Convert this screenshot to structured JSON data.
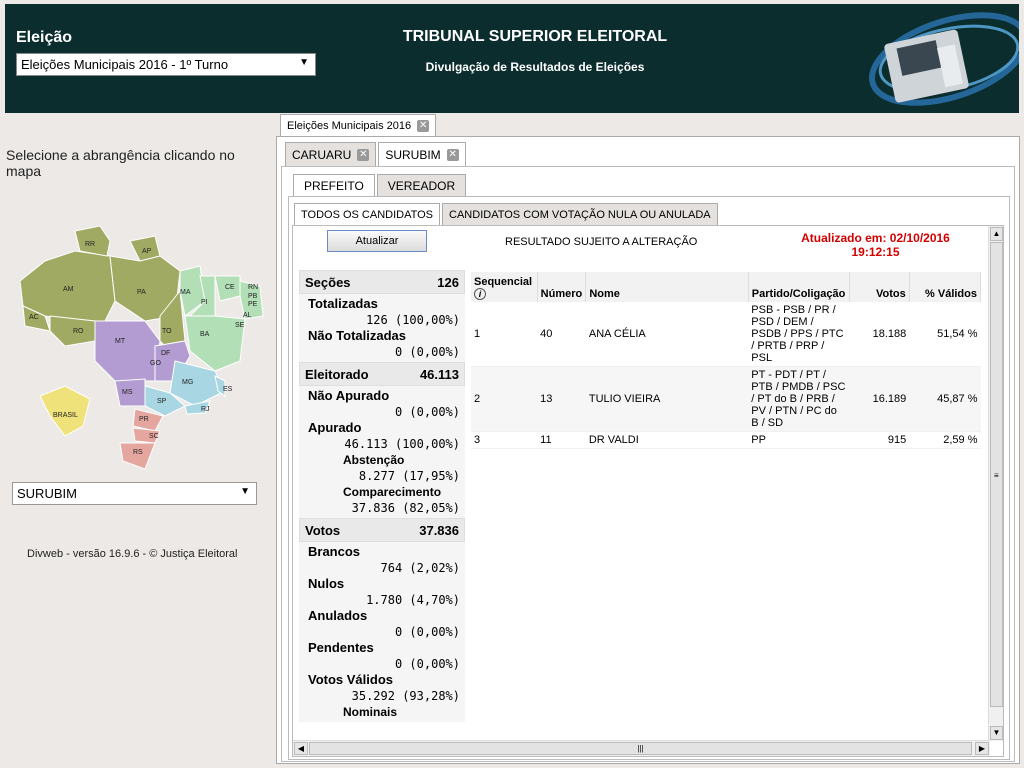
{
  "header": {
    "eleicao_label": "Eleição",
    "eleicao_selected": "Eleições Municipais 2016 - 1º Turno",
    "title": "TRIBUNAL SUPERIOR ELEITORAL",
    "subtitle": "Divulgação de Resultados de Eleições"
  },
  "left": {
    "instruction": "Selecione a abrangência clicando no mapa",
    "municipio_selected": "SURUBIM",
    "footer": "Divweb - versão 16.9.6 - © Justiça Eleitoral",
    "map_labels": [
      "RR",
      "AP",
      "AM",
      "PA",
      "MA",
      "CE",
      "RN",
      "PB",
      "PE",
      "AL",
      "SE",
      "PI",
      "AC",
      "RO",
      "TO",
      "BA",
      "MT",
      "DF",
      "GO",
      "MG",
      "ES",
      "MS",
      "SP",
      "RJ",
      "PR",
      "SC",
      "RS",
      "BRASIL"
    ]
  },
  "tabs": {
    "eleicao_tab": "Eleições Municipais 2016",
    "municipios": [
      "CARUARU",
      "SURUBIM"
    ],
    "cargos": [
      "PREFEITO",
      "VEREADOR"
    ],
    "views": [
      "TODOS OS CANDIDATOS",
      "CANDIDATOS COM VOTAÇÃO NULA OU ANULADA"
    ]
  },
  "toolbar": {
    "atualizar": "Atualizar",
    "aviso": "RESULTADO SUJEITO A ALTERAÇÃO",
    "atualizado_line1": "Atualizado em: 02/10/2016",
    "atualizado_line2": "19:12:15"
  },
  "summary": {
    "secoes": {
      "label": "Seções",
      "value": "126"
    },
    "totalizadas": {
      "label": "Totalizadas",
      "value": "126 (100,00%)"
    },
    "nao_totalizadas": {
      "label": "Não Totalizadas",
      "value": "0 (0,00%)"
    },
    "eleitorado": {
      "label": "Eleitorado",
      "value": "46.113"
    },
    "nao_apurado": {
      "label": "Não Apurado",
      "value": "0 (0,00%)"
    },
    "apurado": {
      "label": "Apurado",
      "value": "46.113 (100,00%)"
    },
    "abstencao": {
      "label": "Abstenção",
      "value": "8.277 (17,95%)"
    },
    "comparecimento": {
      "label": "Comparecimento",
      "value": "37.836 (82,05%)"
    },
    "votos": {
      "label": "Votos",
      "value": "37.836"
    },
    "brancos": {
      "label": "Brancos",
      "value": "764 (2,02%)"
    },
    "nulos": {
      "label": "Nulos",
      "value": "1.780 (4,70%)"
    },
    "anulados": {
      "label": "Anulados",
      "value": "0 (0,00%)"
    },
    "pendentes": {
      "label": "Pendentes",
      "value": "0 (0,00%)"
    },
    "votos_validos": {
      "label": "Votos Válidos",
      "value": "35.292 (93,28%)"
    },
    "nominais": {
      "label": "Nominais"
    }
  },
  "table": {
    "headers": {
      "sequencial": "Sequencial",
      "numero": "Número",
      "nome": "Nome",
      "partido": "Partido/Coligação",
      "votos": "Votos",
      "validos": "% Válidos"
    },
    "rows": [
      {
        "seq": "1",
        "numero": "40",
        "nome": "ANA CÉLIA",
        "partido": "PSB - PSB / PR / PSD / DEM / PSDB / PPS / PTC / PRTB / PRP / PSL",
        "votos": "18.188",
        "validos": "51,54 %"
      },
      {
        "seq": "2",
        "numero": "13",
        "nome": "TULIO VIEIRA",
        "partido": "PT - PDT / PT / PTB / PMDB / PSC / PT do B / PRB / PV / PTN / PC do B / SD",
        "votos": "16.189",
        "validos": "45,87 %"
      },
      {
        "seq": "3",
        "numero": "11",
        "nome": "DR VALDI",
        "partido": "PP",
        "votos": "915",
        "validos": "2,59 %"
      }
    ]
  }
}
